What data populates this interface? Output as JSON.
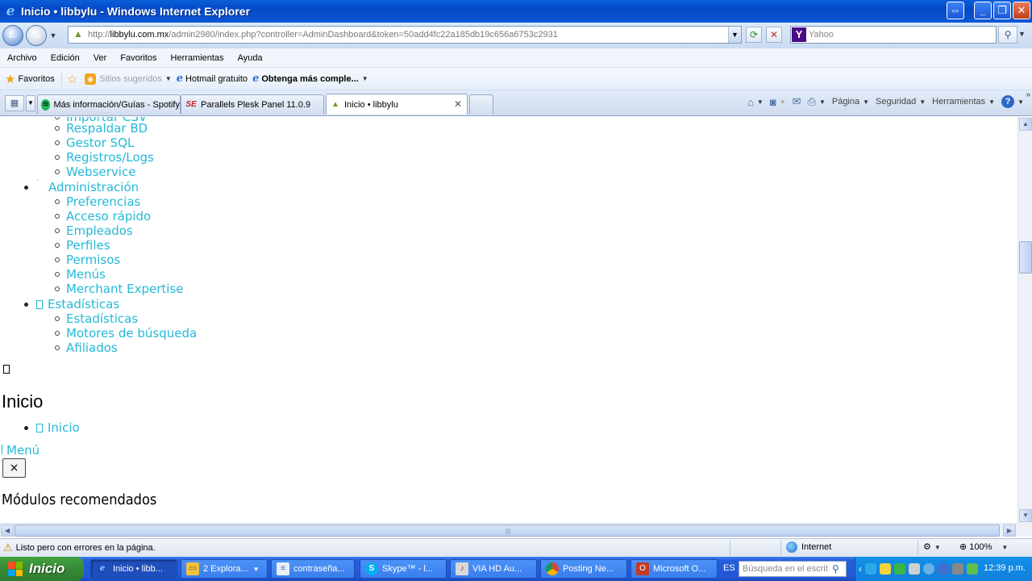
{
  "window": {
    "title": "Inicio • libbylu - Windows Internet Explorer"
  },
  "address_bar": {
    "url_prefix": "http://",
    "url_domain": "libbylu.com.mx",
    "url_path": "/admin2980/index.php?controller=AdminDashboard&token=50add4fc22a185db19c656a6753c2931"
  },
  "search_box": {
    "provider": "Yahoo",
    "placeholder": "Yahoo"
  },
  "menu_bar": [
    "Archivo",
    "Edición",
    "Ver",
    "Favoritos",
    "Herramientas",
    "Ayuda"
  ],
  "favorites_bar": {
    "favorites_label": "Favoritos",
    "sitios_sugeridos": "Sitios sugeridos",
    "hotmail": "Hotmail gratuito",
    "obtenga": "Obtenga más comple..."
  },
  "tabs": [
    {
      "label": "Más información/Guías - Spotify"
    },
    {
      "label": "Parallels Plesk Panel 11.0.9"
    },
    {
      "label": "Inicio • libbylu"
    }
  ],
  "command_bar": {
    "pagina": "Página",
    "seguridad": "Seguridad",
    "herramientas": "Herramientas"
  },
  "content": {
    "partial_item": "Importar CSV",
    "group1_items": [
      "Respaldar BD",
      "Gestor SQL",
      "Registros/Logs",
      "Webservice"
    ],
    "admin_label": "Administración",
    "admin_items": [
      "Preferencias",
      "Acceso rápido",
      "Empleados",
      "Perfiles",
      "Permisos",
      "Menús",
      "Merchant Expertise"
    ],
    "stats_label": "Estadísticas",
    "stats_items": [
      "Estadísticas",
      "Motores de búsqueda",
      "Afiliados"
    ],
    "page_heading": "Inicio",
    "breadcrumb_item": "Inicio",
    "menu_link": "Menú",
    "close_symbol": "×",
    "section_heading": "Módulos recomendados"
  },
  "status_bar": {
    "message": "Listo pero con errores en la página.",
    "zone": "Internet",
    "zoom": "100%"
  },
  "taskbar": {
    "start_label": "Inicio",
    "buttons": [
      {
        "label": "Inicio • libb..."
      },
      {
        "label": "2 Explora..."
      },
      {
        "label": "contraseña..."
      },
      {
        "label": "Skype™ - l..."
      },
      {
        "label": "VIA HD Au..."
      },
      {
        "label": "Posting Ne..."
      },
      {
        "label": "Microsoft O..."
      }
    ],
    "language": "ES",
    "search_placeholder": "Búsqueda en el escrit",
    "clock": "12:39 p.m."
  },
  "colors": {
    "link": "#25b9d7",
    "titlebar": "#0a4fc9",
    "taskbar": "#245edb",
    "start": "#388a38"
  }
}
